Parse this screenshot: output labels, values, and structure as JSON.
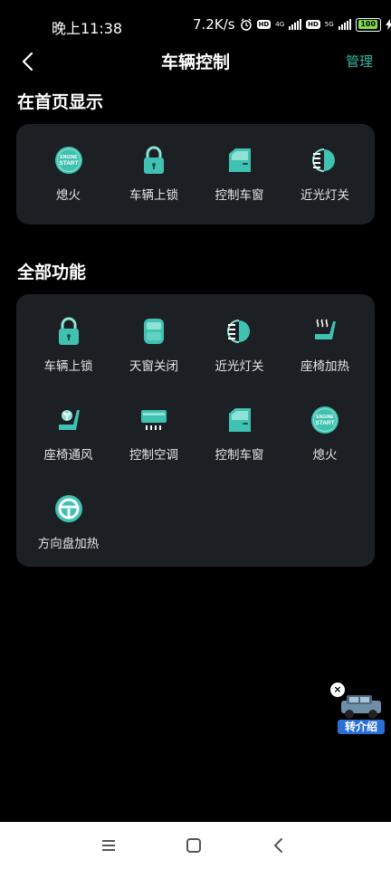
{
  "status_bar": {
    "time": "晚上11:38",
    "speed": "7.2K/s",
    "sim1_type": "4G",
    "sim2_type": "5G",
    "battery": "100"
  },
  "header": {
    "title": "车辆控制",
    "manage": "管理"
  },
  "home_section": {
    "title": "在首页显示",
    "items": [
      {
        "label": "熄火",
        "icon": "engine-start-icon"
      },
      {
        "label": "车辆上锁",
        "icon": "lock-icon"
      },
      {
        "label": "控制车窗",
        "icon": "car-window-icon"
      },
      {
        "label": "近光灯关",
        "icon": "headlight-icon"
      }
    ]
  },
  "all_section": {
    "title": "全部功能",
    "items": [
      {
        "label": "车辆上锁",
        "icon": "lock-icon"
      },
      {
        "label": "天窗关闭",
        "icon": "sunroof-icon"
      },
      {
        "label": "近光灯关",
        "icon": "headlight-icon"
      },
      {
        "label": "座椅加热",
        "icon": "seat-heat-icon"
      },
      {
        "label": "座椅通风",
        "icon": "seat-ventilation-icon"
      },
      {
        "label": "控制空调",
        "icon": "air-conditioner-icon"
      },
      {
        "label": "控制车窗",
        "icon": "car-window-icon"
      },
      {
        "label": "熄火",
        "icon": "engine-start-icon"
      },
      {
        "label": "方向盘加热",
        "icon": "steering-wheel-icon"
      }
    ]
  },
  "engine_icon_text": {
    "line1": "ENGINE",
    "line2": "START"
  },
  "float_ad": {
    "label": "转介绍"
  },
  "colors": {
    "accent": "#35b7a5",
    "card": "#1c1f24",
    "background": "#000000"
  }
}
